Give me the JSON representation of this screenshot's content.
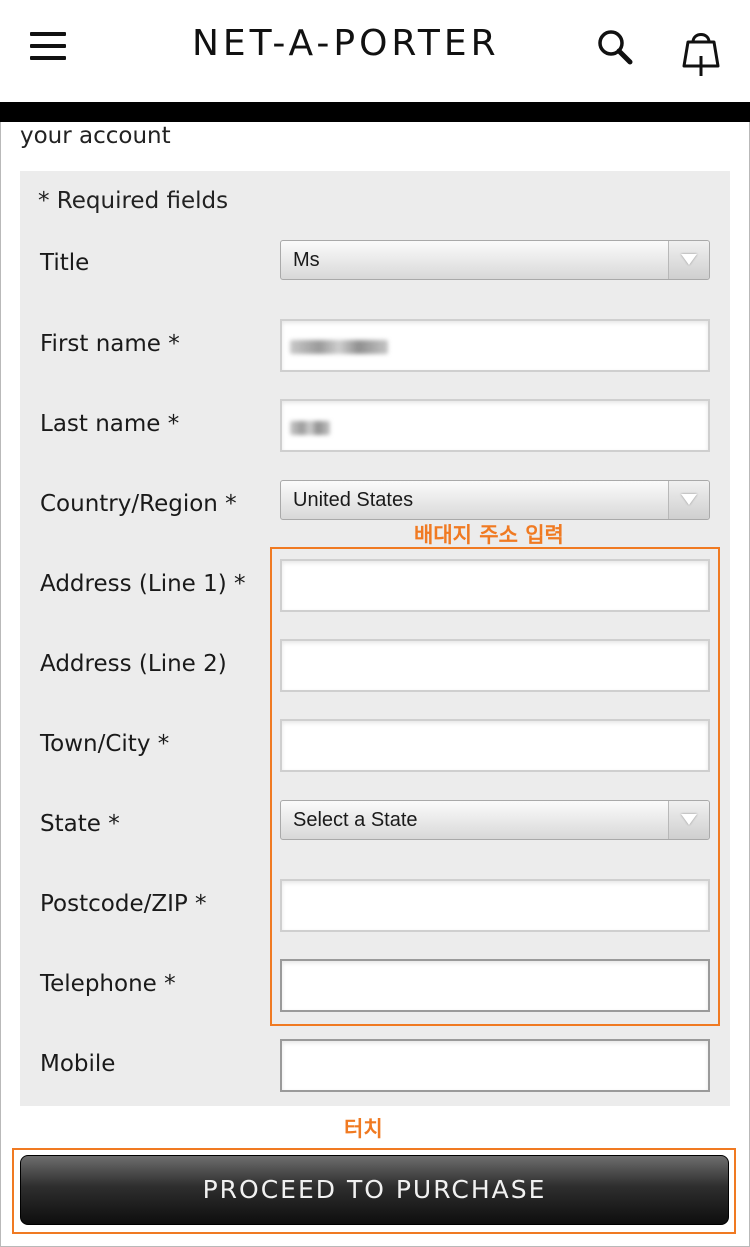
{
  "header": {
    "logo": "NET-A-PORTER",
    "menu_icon": "hamburger-menu-icon",
    "search_icon": "search-icon",
    "bag_icon": "shopping-bag-icon"
  },
  "intro": {
    "text": "your account"
  },
  "form": {
    "required_note": "* Required fields",
    "title": {
      "label": "Title",
      "value": "Ms"
    },
    "first_name": {
      "label": "First name *"
    },
    "last_name": {
      "label": "Last name *"
    },
    "country": {
      "label": "Country/Region *",
      "value": "United States"
    },
    "address1": {
      "label": "Address (Line 1) *",
      "value": ""
    },
    "address2": {
      "label": "Address (Line 2)",
      "value": ""
    },
    "city": {
      "label": "Town/City *",
      "value": ""
    },
    "state": {
      "label": "State *",
      "value": "Select a State"
    },
    "postcode": {
      "label": "Postcode/ZIP *",
      "value": ""
    },
    "telephone": {
      "label": "Telephone *",
      "value": ""
    },
    "mobile": {
      "label": "Mobile",
      "value": ""
    }
  },
  "annotations": {
    "address_note": "배대지 주소 입력",
    "touch_note": "터치",
    "color": "#f07a22"
  },
  "actions": {
    "proceed_label": "PROCEED TO PURCHASE"
  }
}
